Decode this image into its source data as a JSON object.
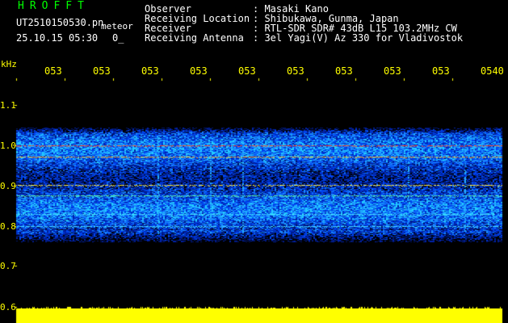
{
  "header": {
    "app_title": "HROFFT",
    "file_name": "UT2510150530.pn",
    "meteor_tag": "meteor",
    "date_time": "25.10.15 05:30",
    "count": "0_"
  },
  "info": [
    {
      "label": "Observer",
      "value": ": Masaki Kano"
    },
    {
      "label": "Receiving Location",
      "value": ": Shibukawa, Gunma, Japan"
    },
    {
      "label": "Receiver",
      "value": ": RTL-SDR SDR# 43dB L15 103.2MHz CW"
    },
    {
      "label": "Receiving Antenna",
      "value": ": 3el Yagi(V) Az 330 for Vladivostok"
    }
  ],
  "time_axis": [
    "053",
    "053",
    "053",
    "053",
    "053",
    "053",
    "053",
    "053",
    "053",
    "0540"
  ],
  "freq_axis": {
    "unit": "kHz",
    "labels": [
      "1.1",
      "1.0",
      "0.9",
      "0.8",
      "0.7",
      "0.6"
    ]
  },
  "colors": {
    "background": "#000000",
    "labels": "#ffff00",
    "title": "#00ff00",
    "noise_band": "#0033cc",
    "signal_line": "#ff3300",
    "audio_level": "#ffff00"
  }
}
